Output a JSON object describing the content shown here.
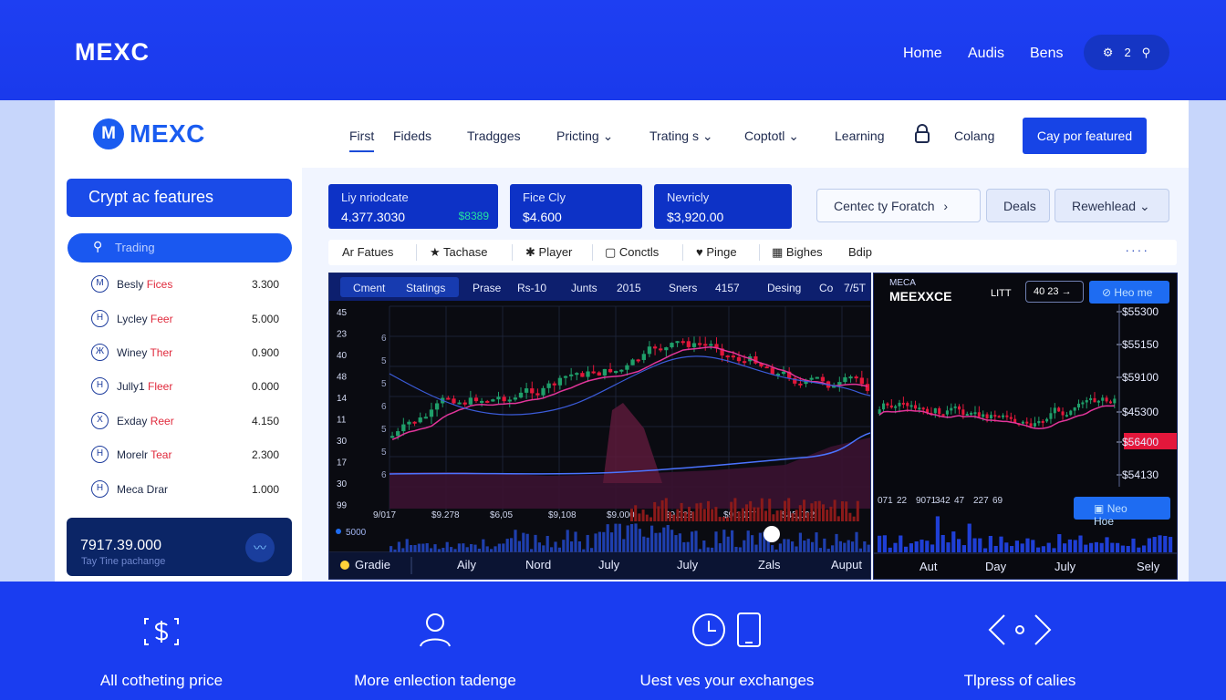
{
  "topbar": {
    "brand": "MEXC",
    "nav": [
      "Home",
      "Audis",
      "Bens"
    ],
    "icon_count": "2"
  },
  "header": {
    "logo_mark": "M",
    "logo_text": "MEXC",
    "nav": [
      {
        "label": "First",
        "active": true
      },
      {
        "label": "Fideds"
      },
      {
        "label": "Tradgges"
      },
      {
        "label": "Pricting",
        "dropdown": true
      },
      {
        "label": "Trating s",
        "dropdown": true
      },
      {
        "label": "Coptotl",
        "dropdown": true
      },
      {
        "label": "Learning"
      },
      {
        "label": "Colang"
      }
    ],
    "cta": "Cay por featured"
  },
  "sidebar": {
    "title": "Crypt ac features",
    "search": "Trading",
    "markets": [
      {
        "icon": "M",
        "name": "Besly",
        "tag": "Fices",
        "value": "3.300"
      },
      {
        "icon": "H",
        "name": "Lycley",
        "tag": "Feer",
        "value": "5.000"
      },
      {
        "icon": "Ж",
        "name": "Winey",
        "tag": "Ther",
        "value": "0.900"
      },
      {
        "icon": "H",
        "name": "Jully1",
        "tag": "Fleer",
        "value": "0.000"
      },
      {
        "icon": "X",
        "name": "Exday",
        "tag": "Reer",
        "value": "4.150"
      },
      {
        "icon": "H",
        "name": "Morelr",
        "tag": "Tear",
        "value": "2.300"
      },
      {
        "icon": "H",
        "name": "Meca Drar",
        "tag": "",
        "value": "1.000"
      }
    ],
    "balance": {
      "value": "7917.39.000",
      "label": "Tay Tine pachange"
    }
  },
  "stats": [
    {
      "label": "Liy nriodcate",
      "value": "4.377.3030",
      "badge": "$8389"
    },
    {
      "label": "Fice Cly",
      "value": "$4.600"
    },
    {
      "label": "Nevricly",
      "value": "$3,920.00"
    }
  ],
  "toolbar": {
    "search": "Centec ty Foratch",
    "deals": "Deals",
    "download": "Rewehlead"
  },
  "tabs": [
    "Ar Fatues",
    "Tachase",
    "Player",
    "Conctls",
    "Pinge",
    "Bighes",
    "Bdip"
  ],
  "main_chart": {
    "header": [
      "Cment",
      "Statings",
      "Prase",
      "Rs-10",
      "Junts",
      "2015",
      "Sners",
      "4157",
      "Desing",
      "Co",
      "7/5T"
    ],
    "y_ticks": [
      "45",
      "23",
      "40",
      "48",
      "14",
      "11",
      "30",
      "17",
      "30",
      "99"
    ],
    "y_inner": [
      "6",
      "5",
      "5",
      "6",
      "5",
      "5",
      "6"
    ],
    "x_ticks": [
      "9/017",
      "$9.278",
      "$6,05",
      "$9,108",
      "$9.000",
      "$9,022",
      "$9,1007",
      "$45,002"
    ],
    "volume_label": "5000",
    "bottom_label": "Gradie",
    "bottom_ticks": [
      "Aily",
      "Nord",
      "July",
      "July",
      "Zals",
      "Auput"
    ]
  },
  "side_chart": {
    "brand_small": "MECA",
    "brand": "MEEXXCE",
    "unit": "LITT",
    "range": "40 23",
    "button": "Heo me",
    "price_ticks": [
      "$55300",
      "$55150",
      "$59100",
      "$45300",
      "$56400",
      "$54130"
    ],
    "info": [
      "071",
      "22",
      "9071",
      "342",
      "47",
      "227",
      "69"
    ],
    "button2": "Neo Hoe",
    "bottom_ticks": [
      "Aut",
      "Day",
      "July",
      "Sely"
    ]
  },
  "features": [
    "All cotheting price",
    "More enlection tadenge",
    "Uest ves your exchanges",
    "Tlpress of calies"
  ],
  "colors": {
    "accent": "#1a44e6",
    "up": "#1f9f6a",
    "down": "#e3173b",
    "ma_line": "#e1359a",
    "ma_line2": "#4b73ff"
  }
}
